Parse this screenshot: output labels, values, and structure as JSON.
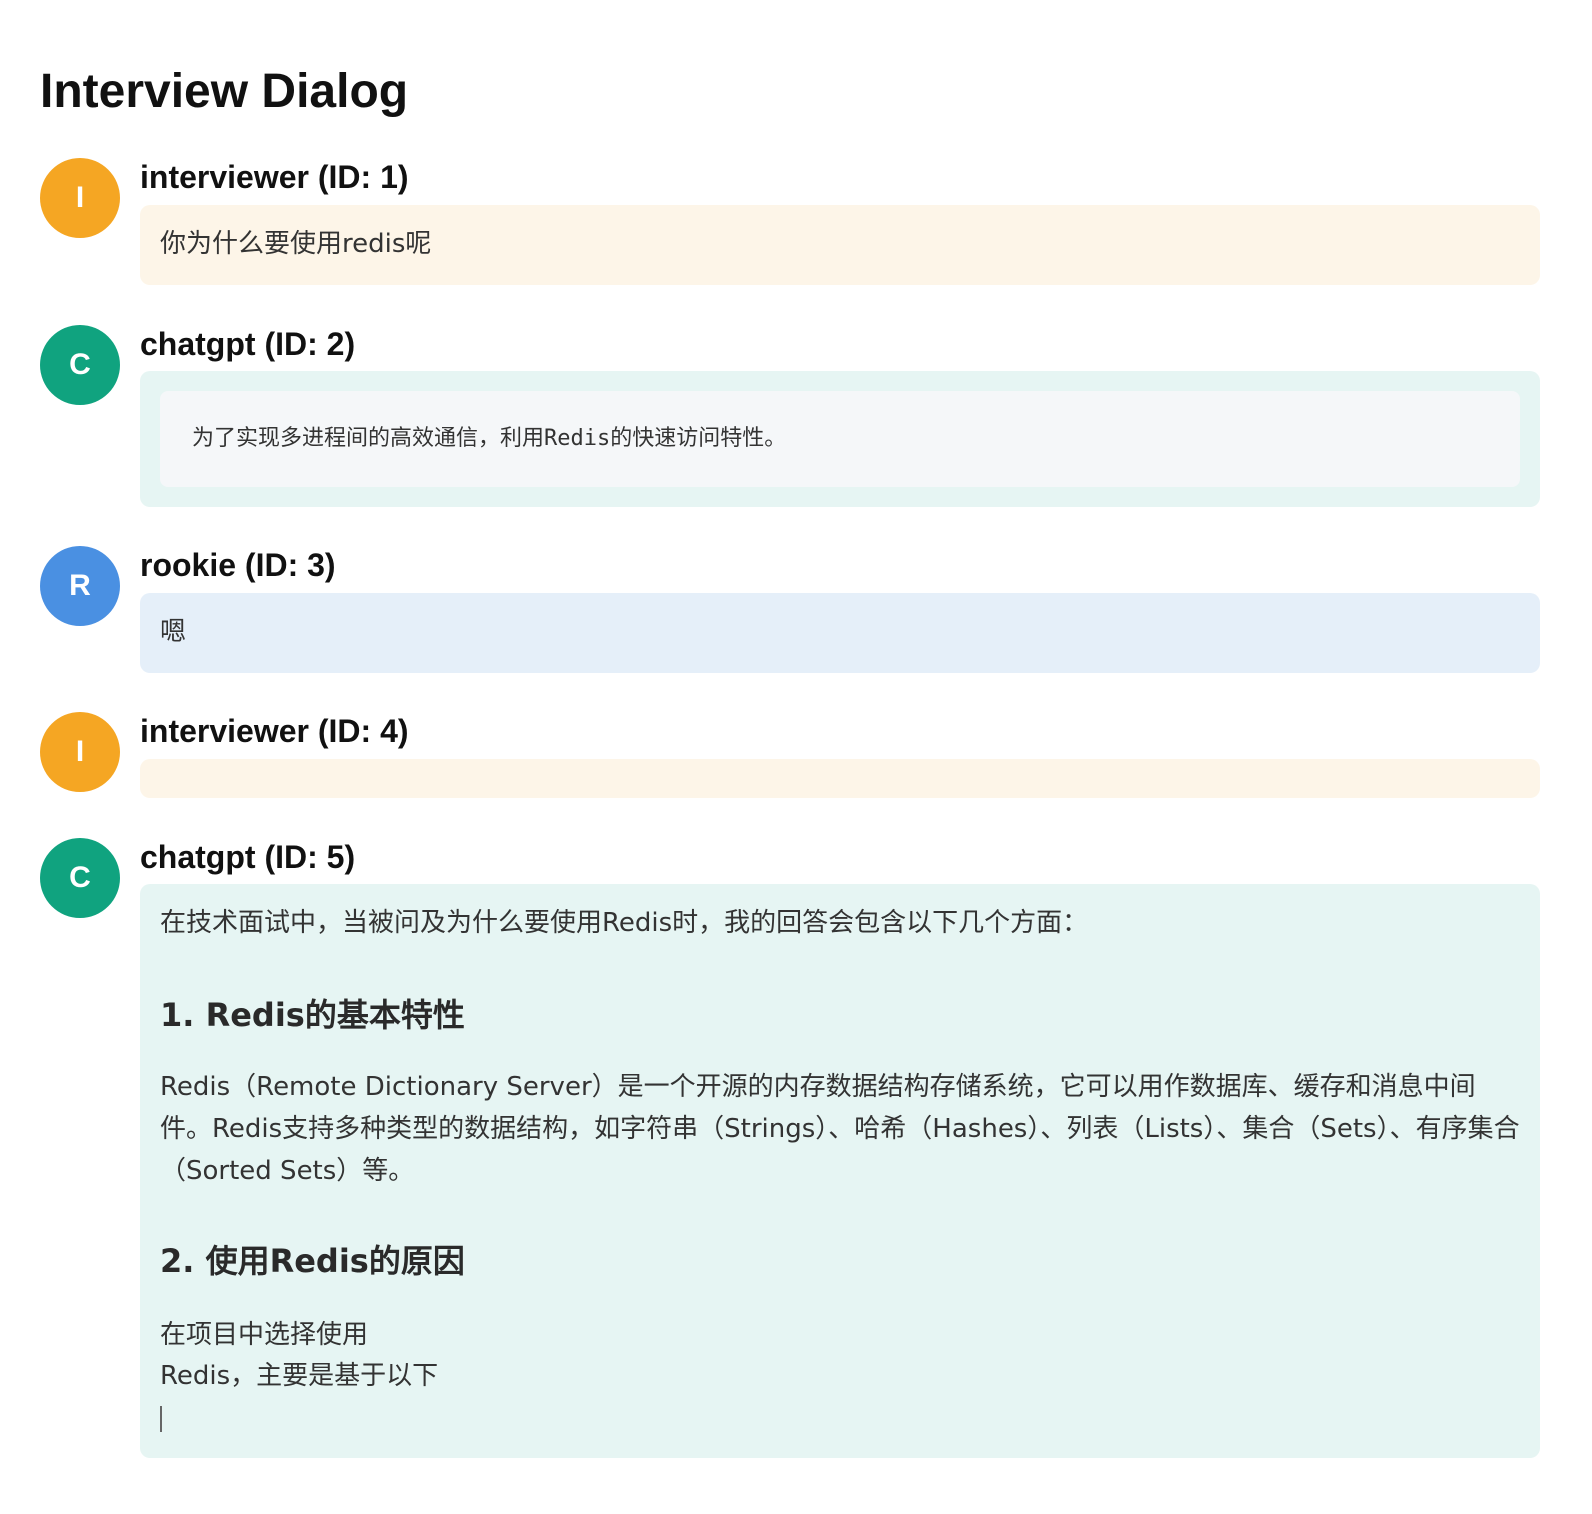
{
  "page": {
    "title": "Interview Dialog"
  },
  "colors": {
    "interviewer_avatar": "#f5a623",
    "chatgpt_avatar": "#10a37f",
    "rookie_avatar": "#4a90e2",
    "interviewer_bubble": "#fdf5e8",
    "chatgpt_bubble": "#e6f5f3",
    "rookie_bubble": "#e5eff9"
  },
  "messages": [
    {
      "role": "interviewer",
      "initial": "I",
      "sender": "interviewer (ID: 1)",
      "text": "你为什么要使用redis呢"
    },
    {
      "role": "chatgpt",
      "initial": "C",
      "sender": "chatgpt (ID: 2)",
      "code": "为了实现多进程间的高效通信，利用Redis的快速访问特性。"
    },
    {
      "role": "rookie",
      "initial": "R",
      "sender": "rookie (ID: 3)",
      "text": "嗯"
    },
    {
      "role": "interviewer",
      "initial": "I",
      "sender": "interviewer (ID: 4)",
      "text": ""
    },
    {
      "role": "chatgpt",
      "initial": "C",
      "sender": "chatgpt (ID: 5)",
      "intro": "在技术面试中，当被问及为什么要使用Redis时，我的回答会包含以下几个方面：",
      "heading1": "1. Redis的基本特性",
      "paragraph1": "Redis（Remote Dictionary Server）是一个开源的内存数据结构存储系统，它可以用作数据库、缓存和消息中间件。Redis支持多种类型的数据结构，如字符串（Strings）、哈希（Hashes）、列表（Lists）、集合（Sets）、有序集合（Sorted Sets）等。",
      "heading2": "2. 使用Redis的原因",
      "line1": "在项目中选择使用",
      "line2": "Redis，主要是基于以下"
    }
  ]
}
